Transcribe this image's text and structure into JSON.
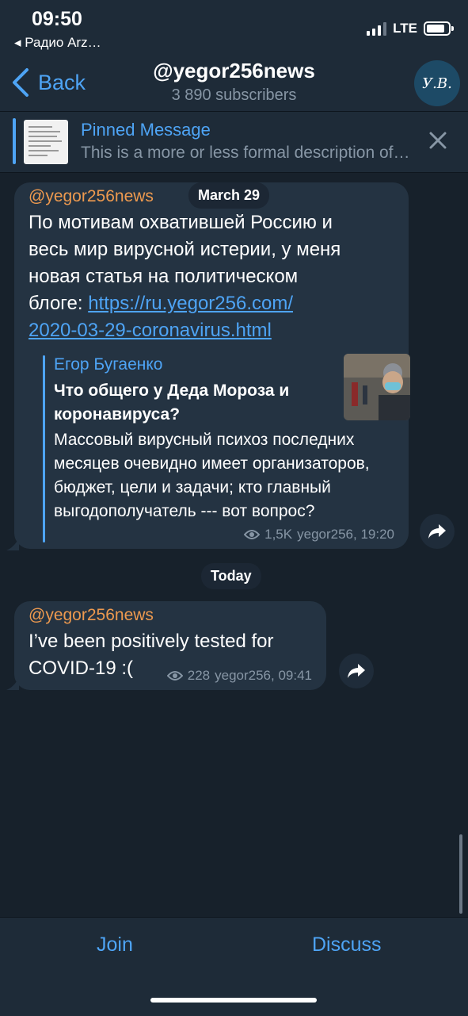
{
  "status_bar": {
    "time": "09:50",
    "back_app": "◂ Радио Arz…",
    "network": "LTE"
  },
  "header": {
    "back_label": "Back",
    "title": "@yegor256news",
    "subtitle": "3 890 subscribers",
    "avatar_text": "У.В."
  },
  "pinned": {
    "title": "Pinned Message",
    "text": "This is a more or less formal description of this channel"
  },
  "messages": [
    {
      "date": "March 29",
      "author": "@yegor256news",
      "text_lines": [
        "По мотивам охватившей Россию и",
        "весь мир вирусной истерии, у меня",
        "новая статья на политическом",
        "блоге: "
      ],
      "link_lines": [
        "https://ru.yegor256.com/",
        "2020-03-29-coronavirus.html"
      ],
      "preview": {
        "site": "Егор Бугаенко",
        "title": "Что общего у Деда Мороза и коронавируса?",
        "description": "Массовый вирусный психоз последних месяцев очевидно имеет организаторов, бюджет, цели и задачи; кто главный выгодополучатель --- вот вопрос?"
      },
      "views": "1,5K",
      "signature": "yegor256, 19:20"
    },
    {
      "date": "Today",
      "author": "@yegor256news",
      "text_lines": [
        "I’ve been positively tested for",
        "COVID-19 :("
      ],
      "views": "228",
      "signature": "yegor256, 09:41"
    }
  ],
  "bottom": {
    "join_label": "Join",
    "discuss_label": "Discuss"
  },
  "icons": {
    "back": "chevron-left-icon",
    "close": "close-icon",
    "views": "eye-icon",
    "forward": "share-forward-icon"
  },
  "colors": {
    "accent": "#4ea4f5",
    "author": "#ee9a4f",
    "background": "#17212b",
    "bubble": "#243342"
  }
}
